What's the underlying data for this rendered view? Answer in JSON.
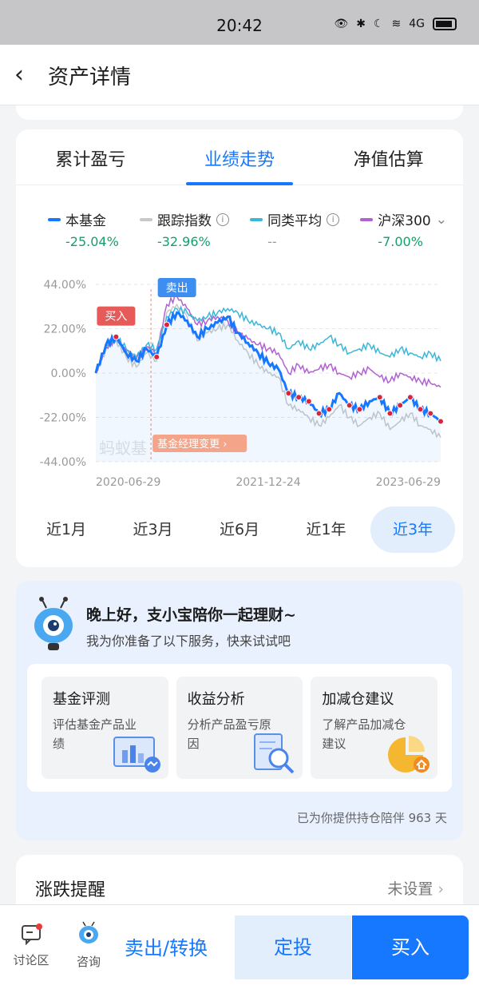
{
  "status": {
    "time": "20:42",
    "signal_label": "4G"
  },
  "nav": {
    "title": "资产详情"
  },
  "tabs": [
    {
      "label": "累计盈亏",
      "active": false
    },
    {
      "label": "业绩走势",
      "active": true
    },
    {
      "label": "净值估算",
      "active": false
    }
  ],
  "legend": [
    {
      "name": "本基金",
      "value": "-25.04%",
      "color": "#1677ff",
      "value_color": "#14a06a"
    },
    {
      "name": "跟踪指数",
      "value": "-32.96%",
      "color": "#c8c8c8",
      "value_color": "#14a06a",
      "info": true
    },
    {
      "name": "同类平均",
      "value": "--",
      "color": "#3bb6d8",
      "value_color": "#999999",
      "info": true
    },
    {
      "name": "沪深300",
      "value": "-7.00%",
      "color": "#b061d2",
      "value_color": "#14a06a",
      "dropdown": true
    }
  ],
  "chart_data": {
    "type": "line",
    "yticks": [
      "44.00%",
      "22.00%",
      "0.00%",
      "-22.00%",
      "-44.00%"
    ],
    "xticks": [
      "2020-06-29",
      "2021-12-24",
      "2023-06-29"
    ],
    "ylim": [
      -44,
      44
    ],
    "watermark": "蚂蚁基",
    "markers": {
      "buy_label": "买入",
      "sell_label": "卖出",
      "manager_change_label": "基金经理变更 ›"
    },
    "series": [
      {
        "name": "本基金",
        "color": "#1677ff",
        "values": [
          0,
          14,
          18,
          10,
          6,
          12,
          8,
          24,
          30,
          26,
          18,
          22,
          25,
          28,
          20,
          15,
          10,
          5,
          2,
          -10,
          -12,
          -14,
          -20,
          -18,
          -10,
          -16,
          -18,
          -14,
          -12,
          -20,
          -16,
          -12,
          -18,
          -20,
          -24
        ]
      },
      {
        "name": "跟踪指数",
        "color": "#c8c8c8",
        "values": [
          0,
          12,
          16,
          8,
          3,
          10,
          6,
          30,
          34,
          28,
          16,
          20,
          22,
          24,
          16,
          10,
          4,
          0,
          -2,
          -16,
          -18,
          -22,
          -26,
          -22,
          -16,
          -22,
          -26,
          -22,
          -20,
          -28,
          -24,
          -20,
          -26,
          -28,
          -32
        ]
      },
      {
        "name": "同类平均",
        "color": "#3bb6d8",
        "values": [
          0,
          14,
          18,
          12,
          8,
          14,
          12,
          28,
          32,
          30,
          26,
          28,
          30,
          32,
          30,
          26,
          24,
          22,
          20,
          12,
          16,
          12,
          14,
          18,
          14,
          10,
          12,
          14,
          10,
          8,
          12,
          10,
          8,
          10,
          6
        ]
      },
      {
        "name": "沪深300",
        "color": "#b061d2",
        "values": [
          0,
          13,
          17,
          11,
          7,
          13,
          10,
          34,
          38,
          32,
          24,
          26,
          28,
          26,
          20,
          17,
          14,
          12,
          10,
          0,
          4,
          0,
          2,
          4,
          0,
          -2,
          0,
          2,
          -2,
          -4,
          0,
          -2,
          -4,
          -5,
          -7
        ]
      }
    ]
  },
  "ranges": [
    {
      "label": "近1月",
      "active": false
    },
    {
      "label": "近3月",
      "active": false
    },
    {
      "label": "近6月",
      "active": false
    },
    {
      "label": "近1年",
      "active": false
    },
    {
      "label": "近3年",
      "active": true
    }
  ],
  "assistant": {
    "greeting": "晚上好，支小宝陪你一起理财~",
    "subtitle": "我为你准备了以下服务，快来试试吧",
    "services": [
      {
        "title": "基金评测",
        "desc": "评估基金产品业绩"
      },
      {
        "title": "收益分析",
        "desc": "分析产品盈亏原因"
      },
      {
        "title": "加减仓建议",
        "desc": "了解产品加减仓建议"
      }
    ],
    "footer": "已为你提供持仓陪伴 963 天"
  },
  "reminder": {
    "title": "涨跌提醒",
    "value": "未设置"
  },
  "bottom": {
    "discuss": "讨论区",
    "consult": "咨询",
    "sell": "卖出/转换",
    "dingtou": "定投",
    "buy": "买入"
  }
}
